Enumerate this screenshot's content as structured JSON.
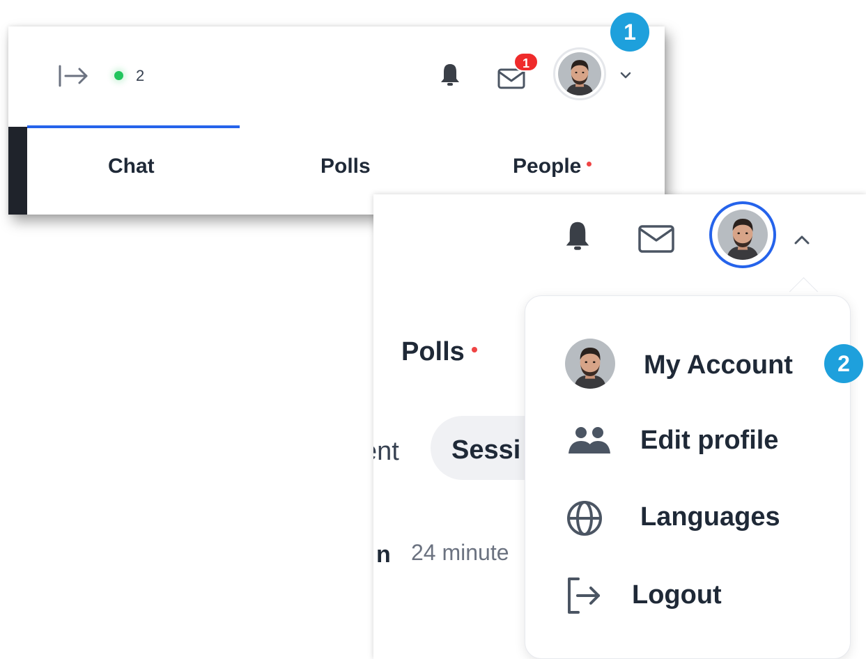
{
  "topbar": {
    "online_count": "2",
    "mail_badge": "1"
  },
  "tabs": [
    {
      "label": "Chat"
    },
    {
      "label": "Polls"
    },
    {
      "label": "People"
    }
  ],
  "panel2": {
    "polls_label": "Polls",
    "partial_tab_text": "ent",
    "session_pill": "Sessi",
    "message_name_fragment": "n",
    "message_time": "24 minute"
  },
  "account_menu": {
    "items": [
      {
        "label": "My Account",
        "icon": "avatar"
      },
      {
        "label": "Edit profile",
        "icon": "users-icon"
      },
      {
        "label": "Languages",
        "icon": "globe-icon"
      },
      {
        "label": "Logout",
        "icon": "logout-icon"
      }
    ]
  },
  "steps": [
    "1",
    "2"
  ],
  "colors": {
    "accent": "#2563eb",
    "online": "#22c55e",
    "badge": "#ef2b2b",
    "step_marker": "#1ea0dc"
  }
}
